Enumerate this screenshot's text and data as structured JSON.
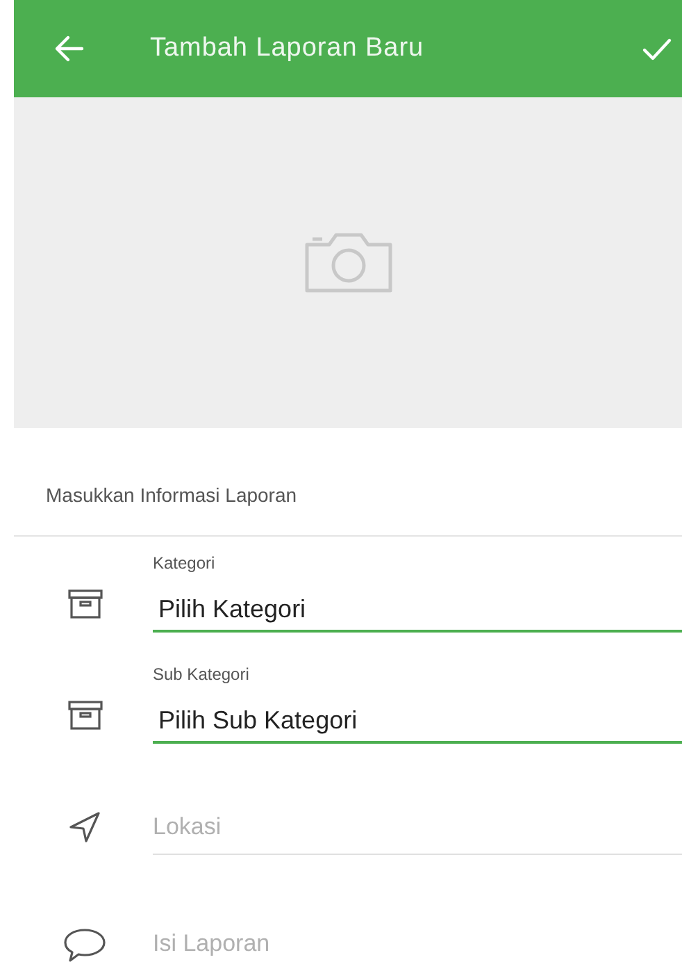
{
  "app_bar": {
    "title": "Tambah Laporan Baru"
  },
  "section_title": "Masukkan Informasi Laporan",
  "fields": [
    {
      "kind": "select",
      "label": "Kategori",
      "value": "Pilih Kategori"
    },
    {
      "kind": "select",
      "label": "Sub Kategori",
      "value": "Pilih Sub Kategori"
    },
    {
      "kind": "location",
      "placeholder": "Lokasi"
    },
    {
      "kind": "message",
      "placeholder": "Isi Laporan"
    }
  ]
}
